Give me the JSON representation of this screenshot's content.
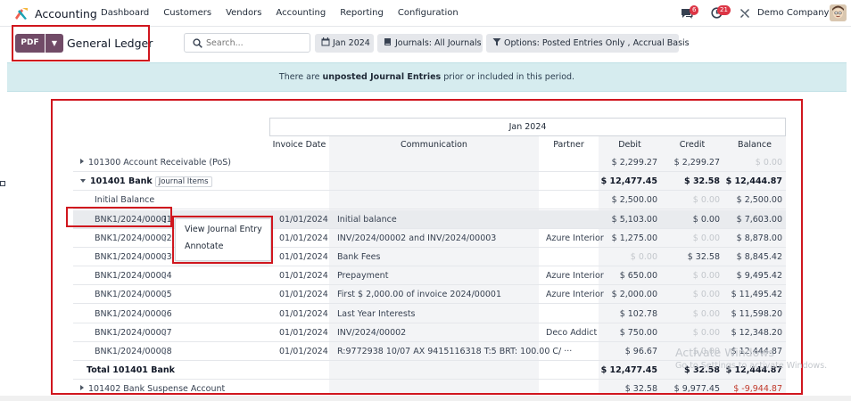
{
  "nav": {
    "app_name": "Accounting",
    "menu": [
      "Dashboard",
      "Customers",
      "Vendors",
      "Accounting",
      "Reporting",
      "Configuration"
    ],
    "chat_badge": "6",
    "activity_badge": "21",
    "company": "Demo Company"
  },
  "control": {
    "pdf_label": "PDF",
    "title": "General Ledger",
    "search_placeholder": "Search...",
    "date_filter": "Jan 2024",
    "journals_filter": "Journals: All Journals",
    "options_filter": "Options: Posted Entries Only , Accrual Basis"
  },
  "alert": {
    "prefix": "There are ",
    "bold": "unposted Journal Entries",
    "suffix": " prior or included in this period."
  },
  "report": {
    "period": "Jan 2024",
    "columns": [
      "Invoice Date",
      "Communication",
      "Partner",
      "Debit",
      "Credit",
      "Balance"
    ],
    "rows": [
      {
        "kind": "account-collapsed",
        "name": "101300 Account Receivable (PoS)",
        "date": "",
        "comm": "",
        "partner": "",
        "debit": "$ 2,299.27",
        "credit": "$ 2,299.27",
        "balance": "$ 0.00",
        "balance_muted": true
      },
      {
        "kind": "account-expanded",
        "name": "101401 Bank",
        "tag": "Journal Items",
        "date": "",
        "comm": "",
        "partner": "",
        "debit": "$ 12,477.45",
        "credit": "$ 32.58",
        "balance": "$ 12,444.87"
      },
      {
        "kind": "initial",
        "name": "Initial Balance",
        "date": "",
        "comm": "",
        "partner": "",
        "debit": "$ 2,500.00",
        "credit": "$ 0.00",
        "credit_muted": true,
        "balance": "$ 2,500.00"
      },
      {
        "kind": "line-selected",
        "name": "BNK1/2024/00001",
        "date": "01/01/2024",
        "comm": "Initial balance",
        "partner": "",
        "debit": "$ 5,103.00",
        "credit": "$ 0.00",
        "balance": "$ 7,603.00"
      },
      {
        "kind": "line",
        "name": "BNK1/2024/00002",
        "date": "01/01/2024",
        "comm": "INV/2024/00002 and INV/2024/00003",
        "partner": "Azure Interior",
        "debit": "$ 1,275.00",
        "credit": "$ 0.00",
        "credit_muted": true,
        "balance": "$ 8,878.00"
      },
      {
        "kind": "line",
        "name": "BNK1/2024/00003",
        "date": "01/01/2024",
        "comm": "Bank Fees",
        "partner": "",
        "debit": "$ 0.00",
        "debit_muted": true,
        "credit": "$ 32.58",
        "balance": "$ 8,845.42"
      },
      {
        "kind": "line",
        "name": "BNK1/2024/00004",
        "date": "01/01/2024",
        "comm": "Prepayment",
        "partner": "Azure Interior",
        "debit": "$ 650.00",
        "credit": "$ 0.00",
        "credit_muted": true,
        "balance": "$ 9,495.42"
      },
      {
        "kind": "line",
        "name": "BNK1/2024/00005",
        "date": "01/01/2024",
        "comm": "First $ 2,000.00 of invoice 2024/00001",
        "partner": "Azure Interior",
        "debit": "$ 2,000.00",
        "credit": "$ 0.00",
        "credit_muted": true,
        "balance": "$ 11,495.42"
      },
      {
        "kind": "line",
        "name": "BNK1/2024/00006",
        "date": "01/01/2024",
        "comm": "Last Year Interests",
        "partner": "",
        "debit": "$ 102.78",
        "credit": "$ 0.00",
        "credit_muted": true,
        "balance": "$ 11,598.20"
      },
      {
        "kind": "line",
        "name": "BNK1/2024/00007",
        "date": "01/01/2024",
        "comm": "INV/2024/00002",
        "partner": "Deco Addict",
        "debit": "$ 750.00",
        "credit": "$ 0.00",
        "credit_muted": true,
        "balance": "$ 12,348.20"
      },
      {
        "kind": "line",
        "name": "BNK1/2024/00008",
        "date": "01/01/2024",
        "comm": "R:9772938 10/07 AX 9415116318 T:5 BRT: 100.00 C/ ···",
        "partner": "",
        "debit": "$ 96.67",
        "credit": "$ 0.00",
        "credit_muted": true,
        "balance": "$ 12,444.87"
      },
      {
        "kind": "total",
        "name": "Total 101401 Bank",
        "date": "",
        "comm": "",
        "partner": "",
        "debit": "$ 12,477.45",
        "credit": "$ 32.58",
        "balance": "$ 12,444.87"
      },
      {
        "kind": "account-collapsed",
        "name": "101402 Bank Suspense Account",
        "date": "",
        "comm": "",
        "partner": "",
        "debit": "$ 32.58",
        "credit": "$ 9,977.45",
        "balance": "$ -9,944.87",
        "balance_negative": true
      }
    ]
  },
  "context_menu": {
    "items": [
      "View Journal Entry",
      "Annotate"
    ]
  },
  "watermark": {
    "line1": "Activate Windows",
    "line2": "Go to Settings to activate Windows."
  },
  "colors": {
    "brand": "#714B67",
    "annotation_red": "#d0161e",
    "alert_bg": "#d6ecef"
  }
}
